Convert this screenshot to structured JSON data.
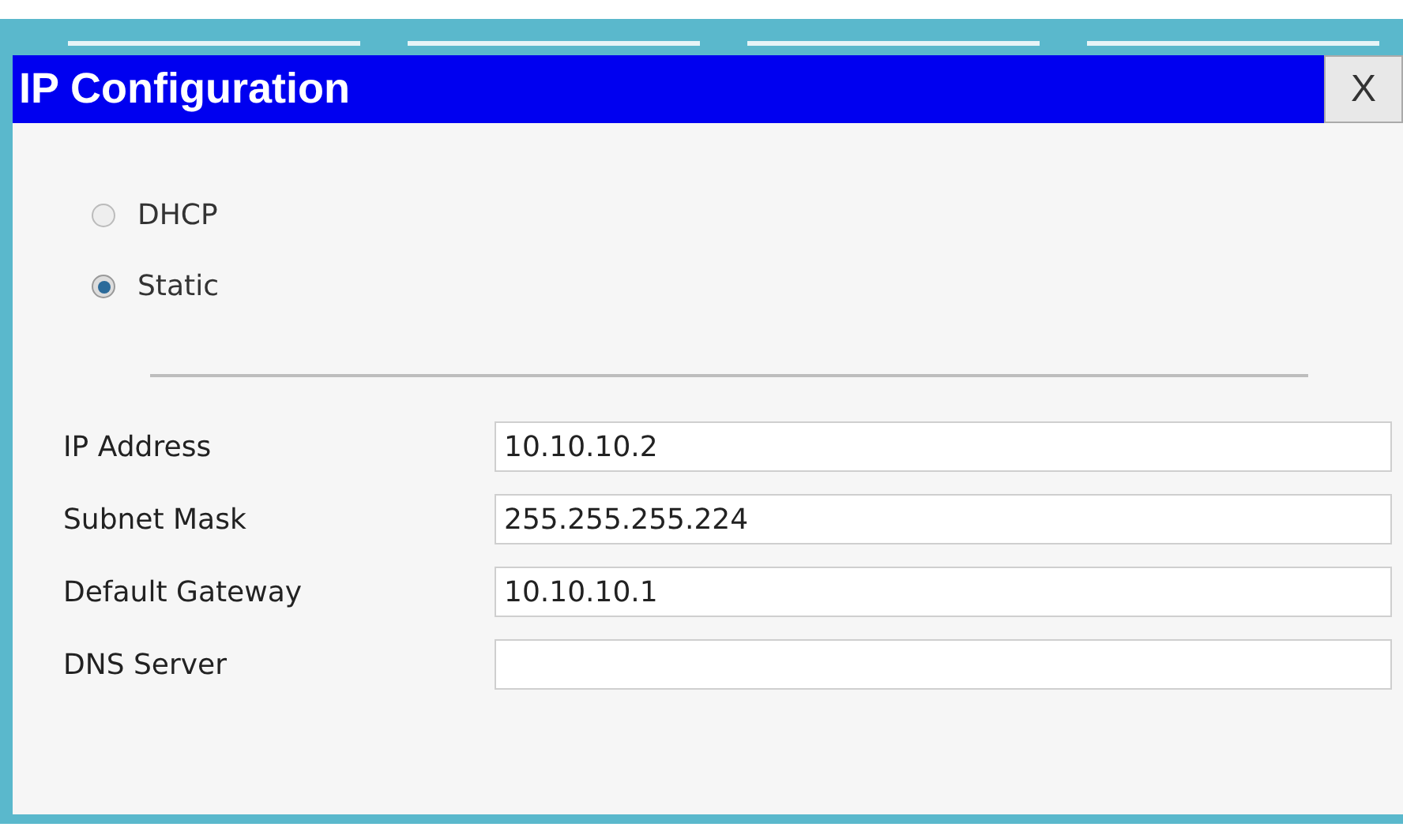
{
  "window": {
    "title": "IP Configuration",
    "close": "X"
  },
  "modes": [
    {
      "label": "DHCP",
      "selected": false
    },
    {
      "label": "Static",
      "selected": true
    }
  ],
  "fields": [
    {
      "label": "IP Address",
      "value": "10.10.10.2"
    },
    {
      "label": "Subnet Mask",
      "value": "255.255.255.224"
    },
    {
      "label": "Default Gateway",
      "value": "10.10.10.1"
    },
    {
      "label": "DNS Server"
    }
  ]
}
